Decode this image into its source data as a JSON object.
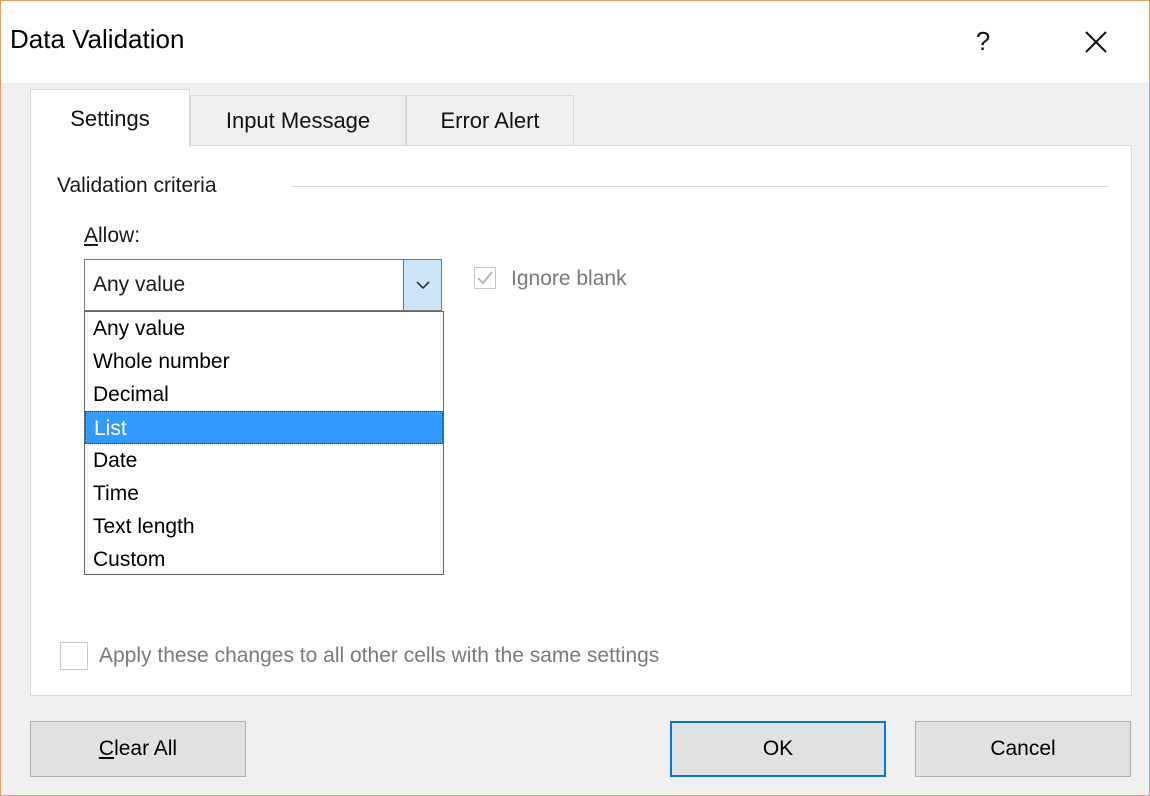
{
  "window": {
    "title": "Data Validation",
    "help_label": "?",
    "close_icon": "close-icon"
  },
  "tabs": [
    {
      "label": "Settings",
      "active": true
    },
    {
      "label": "Input Message",
      "active": false
    },
    {
      "label": "Error Alert",
      "active": false
    }
  ],
  "settings": {
    "group_label": "Validation criteria",
    "allow_label_access_key": "A",
    "allow_label_rest": "llow:",
    "allow_value": "Any value",
    "dropdown_options": [
      "Any value",
      "Whole number",
      "Decimal",
      "List",
      "Date",
      "Time",
      "Text length",
      "Custom"
    ],
    "highlighted_option": "List",
    "ignore_blank_label": "Ignore blank",
    "ignore_blank_checked": true,
    "ignore_blank_enabled": false,
    "apply_label": "Apply these changes to all other cells with the same settings",
    "apply_checked": false,
    "apply_enabled": false
  },
  "buttons": {
    "clear_all_access_key": "C",
    "clear_all_rest": "lear All",
    "ok_label": "OK",
    "cancel_label": "Cancel"
  },
  "colors": {
    "highlight": "#3399ff",
    "combo_arrow_bg": "#cce4f7",
    "default_button_border": "#0078d7",
    "window_border": "#e8a15a"
  }
}
